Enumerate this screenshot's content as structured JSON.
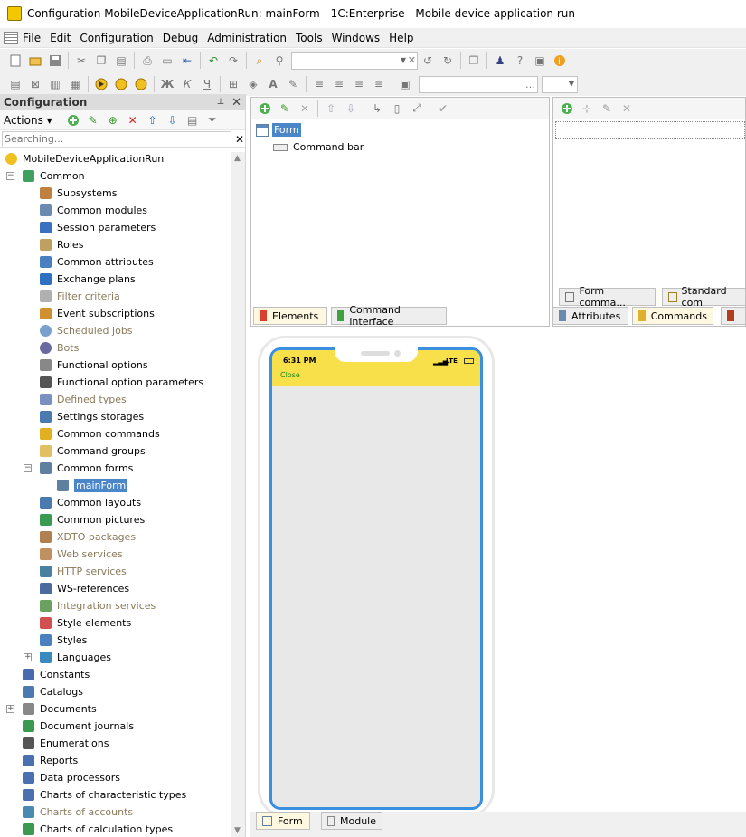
{
  "window": {
    "title": "Configuration MobileDeviceApplicationRun: mainForm - 1C:Enterprise - Mobile device application run"
  },
  "menu": [
    "File",
    "Edit",
    "Configuration",
    "Debug",
    "Administration",
    "Tools",
    "Windows",
    "Help"
  ],
  "config_panel": {
    "title": "Configuration",
    "actions_label": "Actions",
    "search_placeholder": "Searching...",
    "tree": [
      {
        "label": "MobileDeviceApplicationRun",
        "icon": "config-root-icon",
        "muted": false
      },
      {
        "label": "Common",
        "icon": "common-icon",
        "muted": false
      },
      {
        "label": "Subsystems",
        "icon": "subsystems-icon",
        "muted": false
      },
      {
        "label": "Common modules",
        "icon": "module-icon",
        "muted": false
      },
      {
        "label": "Session parameters",
        "icon": "session-icon",
        "muted": false
      },
      {
        "label": "Roles",
        "icon": "roles-icon",
        "muted": false
      },
      {
        "label": "Common attributes",
        "icon": "attribute-icon",
        "muted": false
      },
      {
        "label": "Exchange plans",
        "icon": "exchange-icon",
        "muted": false
      },
      {
        "label": "Filter criteria",
        "icon": "filter-icon",
        "muted": true
      },
      {
        "label": "Event subscriptions",
        "icon": "event-icon",
        "muted": false
      },
      {
        "label": "Scheduled jobs",
        "icon": "clock-icon",
        "muted": true
      },
      {
        "label": "Bots",
        "icon": "bot-icon",
        "muted": true
      },
      {
        "label": "Functional options",
        "icon": "options-icon",
        "muted": false
      },
      {
        "label": "Functional option parameters",
        "icon": "params-icon",
        "muted": false
      },
      {
        "label": "Defined types",
        "icon": "types-icon",
        "muted": true
      },
      {
        "label": "Settings storages",
        "icon": "storage-icon",
        "muted": false
      },
      {
        "label": "Common commands",
        "icon": "command-icon",
        "muted": false
      },
      {
        "label": "Command groups",
        "icon": "folder-icon",
        "muted": false
      },
      {
        "label": "Common forms",
        "icon": "form-icon",
        "muted": false
      },
      {
        "label": "mainForm",
        "icon": "form-icon",
        "muted": false,
        "selected": true
      },
      {
        "label": "Common layouts",
        "icon": "layout-icon",
        "muted": false
      },
      {
        "label": "Common pictures",
        "icon": "picture-icon",
        "muted": false
      },
      {
        "label": "XDTO packages",
        "icon": "package-icon",
        "muted": true
      },
      {
        "label": "Web services",
        "icon": "web-icon",
        "muted": true
      },
      {
        "label": "HTTP services",
        "icon": "http-icon",
        "muted": true
      },
      {
        "label": "WS-references",
        "icon": "ws-icon",
        "muted": false
      },
      {
        "label": "Integration services",
        "icon": "integration-icon",
        "muted": true
      },
      {
        "label": "Style elements",
        "icon": "style-element-icon",
        "muted": false
      },
      {
        "label": "Styles",
        "icon": "styles-icon",
        "muted": false
      },
      {
        "label": "Languages",
        "icon": "languages-icon",
        "muted": false
      },
      {
        "label": "Constants",
        "icon": "constants-icon",
        "muted": false
      },
      {
        "label": "Catalogs",
        "icon": "catalogs-icon",
        "muted": false
      },
      {
        "label": "Documents",
        "icon": "documents-icon",
        "muted": false
      },
      {
        "label": "Document journals",
        "icon": "journals-icon",
        "muted": false
      },
      {
        "label": "Enumerations",
        "icon": "enum-icon",
        "muted": false
      },
      {
        "label": "Reports",
        "icon": "reports-icon",
        "muted": false
      },
      {
        "label": "Data processors",
        "icon": "processors-icon",
        "muted": false
      },
      {
        "label": "Charts of characteristic types",
        "icon": "chart-types-icon",
        "muted": false
      },
      {
        "label": "Charts of accounts",
        "icon": "accounts-icon",
        "muted": true
      },
      {
        "label": "Charts of calculation types",
        "icon": "calc-icon",
        "muted": false
      }
    ]
  },
  "form_tree": {
    "items": [
      {
        "label": "Form",
        "selected": true
      },
      {
        "label": "Command bar",
        "selected": false
      }
    ],
    "tabs": [
      "Elements",
      "Command interface"
    ]
  },
  "right_panel": {
    "subtabs": [
      "Form comma...",
      "Standard com"
    ],
    "tabs": [
      "Attributes",
      "Commands"
    ]
  },
  "phone": {
    "time": "6:31 PM",
    "network": "LTE",
    "close_label": "Close"
  },
  "bottom_tabs": [
    "Form",
    "Module"
  ],
  "colors": {
    "accent": "#3a8fe0",
    "status": "#f7e04a",
    "selection": "#4a86c8"
  }
}
